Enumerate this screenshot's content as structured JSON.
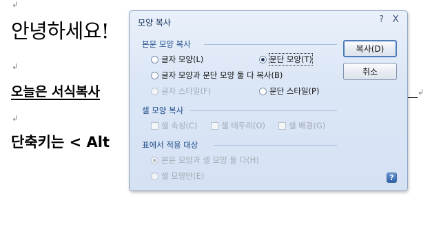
{
  "document": {
    "para_mark": "↲",
    "line1": "안녕하세요!",
    "line2": "오늘은  서식복사",
    "line3": "단축키는 < Alt"
  },
  "dialog": {
    "title": "모양 복사",
    "help_glyph": "?",
    "close_glyph": "X",
    "groups": {
      "paragraph": {
        "label": "본문 모양 복사",
        "char_shape": "글자 모양(L)",
        "para_shape": "문단 모양(T)",
        "both": "글자 모양과 문단 모양 둘 다 복사(B)",
        "char_style": "글자 스타일(F)",
        "para_style": "문단 스타일(P)",
        "selected": "para_shape"
      },
      "cell": {
        "label": "셀 모양 복사",
        "attr": "셀 속성(C)",
        "border": "셀 테두리(O)",
        "background": "셀 배경(G)"
      },
      "table": {
        "label": "표에서 적용 대상",
        "both": "본문 모양과 셀 모양 둘 다(H)",
        "cell_only": "셀 모양만(E)",
        "selected": "both"
      }
    },
    "buttons": {
      "copy": "복사(D)",
      "cancel": "취소",
      "help": "?"
    }
  }
}
